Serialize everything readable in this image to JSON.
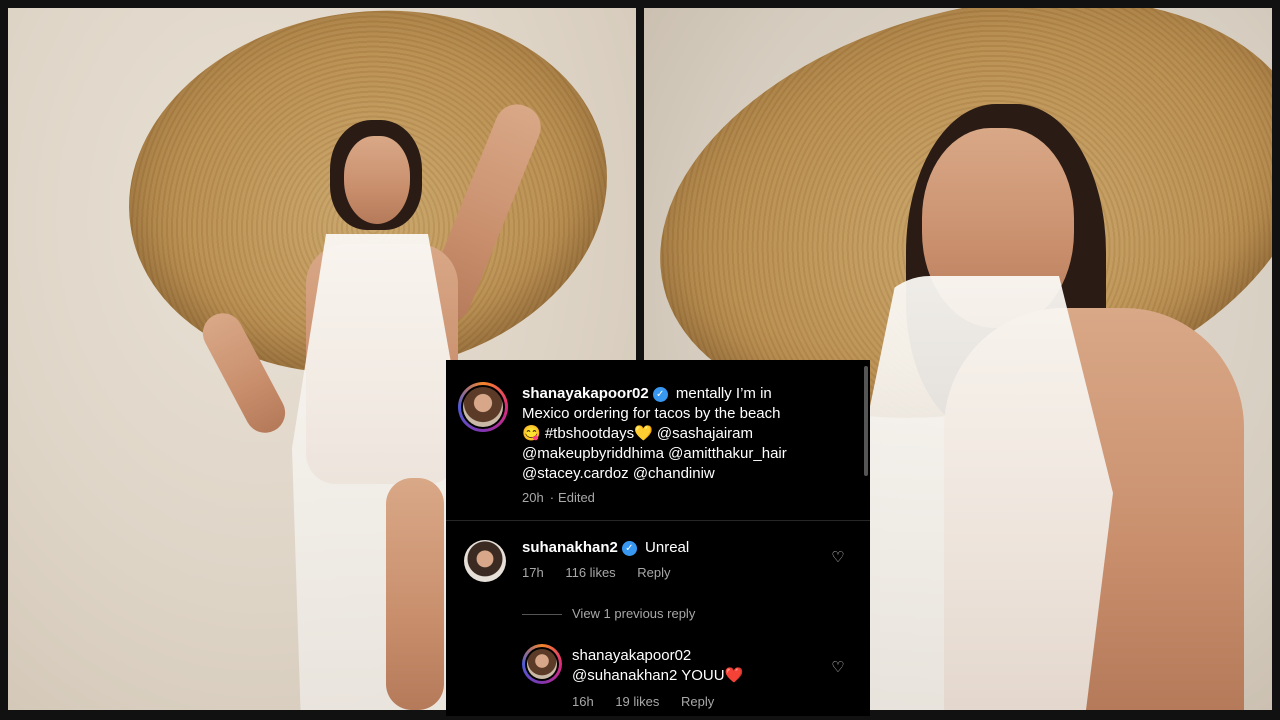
{
  "post": {
    "username": "shanayakapoor02",
    "caption": "mentally I’m in Mexico ordering for tacos by the beach 😋 #tbshootdays💛 @sashajairam @makeupbyriddhima @amitthakur_hair @stacey.cardoz @chandiniw",
    "caption_lines": [
      "mentally I’m in",
      "Mexico ordering for tacos by the beach",
      "😋 #tbshootdays💛 @sashajairam",
      "@makeupbyriddhima @amitthakur_hair",
      "@stacey.cardoz @chandiniw"
    ],
    "time": "20h",
    "edited": "Edited"
  },
  "comments": [
    {
      "username": "suhanakhan2",
      "text": "Unreal",
      "time": "17h",
      "likes": "116 likes",
      "reply_label": "Reply"
    }
  ],
  "view_replies": "View 1 previous reply",
  "reply": {
    "username": "shanayakapoor02",
    "text": "@suhanakhan2 YOUU❤️",
    "time": "16h",
    "likes": "19 likes",
    "reply_label": "Reply"
  },
  "icons": {
    "verified": "verified-badge-icon",
    "heart": "heart-outline-icon"
  },
  "colors": {
    "panel_bg": "#000000",
    "verified_blue": "#3897f0",
    "muted_text": "#a8a8a8"
  }
}
